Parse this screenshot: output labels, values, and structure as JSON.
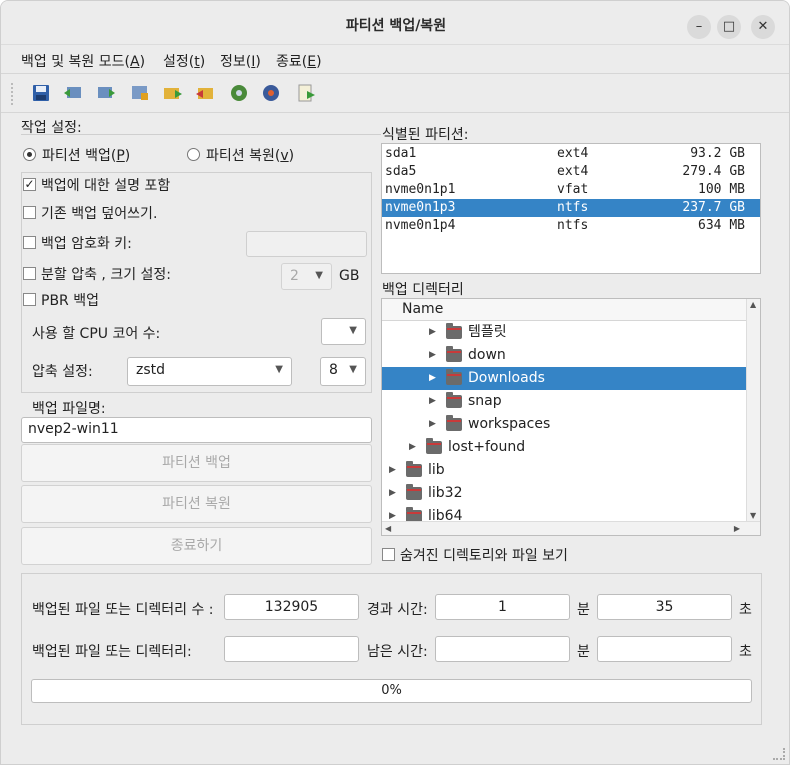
{
  "window": {
    "title": "파티션 백업/복원"
  },
  "window_controls": {
    "minimize": "–",
    "maximize": "□",
    "close": "✕"
  },
  "menu": [
    {
      "label": "백업 및 복원 모드",
      "accel": "A"
    },
    {
      "label": "설정",
      "accel": "t"
    },
    {
      "label": "정보",
      "accel": "I"
    },
    {
      "label": "종료",
      "accel": "E"
    }
  ],
  "toolbar": {
    "icons": [
      "save-icon",
      "backup-partition-icon",
      "restore-partition-icon",
      "image-file-icon",
      "folder-forward-icon",
      "folder-back-icon",
      "globe-icon",
      "globe-settings-icon",
      "export-document-icon"
    ]
  },
  "work_settings": {
    "title": "작업 설정:",
    "radio_backup": {
      "label": "파티션 백업",
      "accel": "P",
      "checked": true
    },
    "radio_restore": {
      "label": "파티션 복원",
      "accel": "v",
      "checked": false
    },
    "include_description": {
      "label": "백업에 대한 설명 포함",
      "checked": true
    },
    "overwrite_backup": {
      "label": "기존 백업 덮어쓰기.",
      "checked": false
    },
    "encrypt_key": {
      "label": "백업 암호화 키:",
      "checked": false,
      "value": ""
    },
    "split": {
      "label": "분할 압축 , 크기 설정:",
      "checked": false,
      "value": "2",
      "unit": "GB"
    },
    "pbr_backup": {
      "label": "PBR 백업",
      "checked": false
    },
    "cpu_cores": {
      "label": "사용 할 CPU 코어 수:",
      "value": ""
    },
    "compression": {
      "label": "압축 설정:",
      "method": "zstd",
      "level": "8"
    }
  },
  "backup_filename": {
    "label": "백업 파일명:",
    "value": "nvep2-win11"
  },
  "buttons": {
    "backup": "파티션 백업",
    "restore": "파티션 복원",
    "quit": "종료하기"
  },
  "partitions": {
    "title": "식별된 파티션:",
    "rows": [
      {
        "name": "sda1",
        "fs": "ext4",
        "size": "93.2 GB",
        "selected": false
      },
      {
        "name": "sda5",
        "fs": "ext4",
        "size": "279.4 GB",
        "selected": false
      },
      {
        "name": "nvme0n1p1",
        "fs": "vfat",
        "size": "100 MB",
        "selected": false
      },
      {
        "name": "nvme0n1p3",
        "fs": "ntfs",
        "size": "237.7 GB",
        "selected": true
      },
      {
        "name": "nvme0n1p4",
        "fs": "ntfs",
        "size": "634 MB",
        "selected": false
      }
    ]
  },
  "backup_dir": {
    "title": "백업 디렉터리",
    "header": "Name",
    "rows": [
      {
        "name": "템플릿",
        "selected": false
      },
      {
        "name": "down",
        "selected": false
      },
      {
        "name": "Downloads",
        "selected": true
      },
      {
        "name": "snap",
        "selected": false
      },
      {
        "name": "workspaces",
        "selected": false
      },
      {
        "name": "lost+found",
        "selected": false
      },
      {
        "name": "lib",
        "selected": false
      },
      {
        "name": "lib32",
        "selected": false
      },
      {
        "name": "lib64",
        "selected": false
      }
    ],
    "show_hidden": {
      "label": "숨겨진 디렉토리와 파일 보기",
      "checked": false
    }
  },
  "status": {
    "files_count_label": "백업된 파일 또는 디렉터리 수 :",
    "files_count": "132905",
    "elapsed_label": "경과 시간:",
    "elapsed_min": "1",
    "min_unit": "분",
    "elapsed_sec": "35",
    "sec_unit": "초",
    "current_file_label": "백업된 파일 또는 디렉터리:",
    "current_file": "",
    "remaining_label": "남은 시간:",
    "remaining_min": "",
    "remaining_sec": "",
    "progress": 0,
    "progress_label": "0%"
  }
}
